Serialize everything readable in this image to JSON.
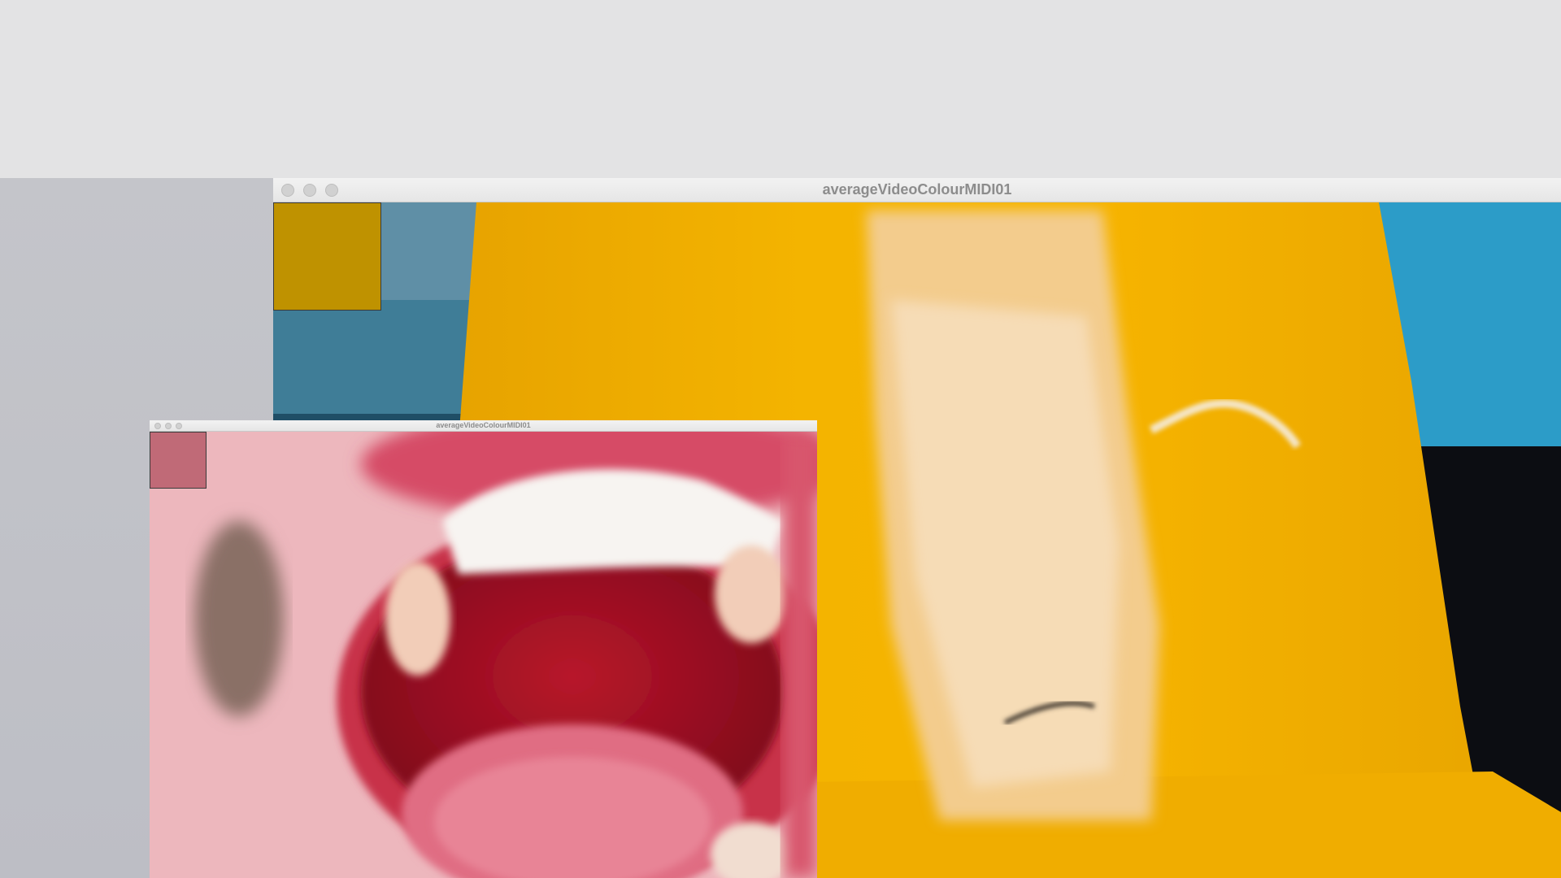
{
  "windows": {
    "main": {
      "title": "averageVideoColourMIDI01",
      "average_colour": "#bf9200",
      "feed_description_icon": "camera-feed-icon"
    },
    "small": {
      "title": "averageVideoColourMIDI01",
      "average_colour": "#c06a77",
      "feed_description_icon": "camera-feed-icon"
    }
  },
  "colors": {
    "titlebar_text": "#8c8c8c",
    "desktop": "#c4c5ca",
    "top_area": "#e3e3e4"
  }
}
